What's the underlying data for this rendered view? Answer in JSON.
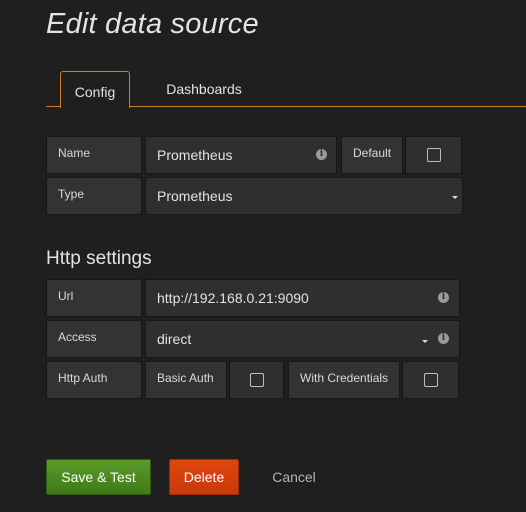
{
  "page": {
    "title": "Edit data source"
  },
  "tabs": [
    {
      "label": "Config",
      "active": true
    },
    {
      "label": "Dashboards",
      "active": false
    }
  ],
  "general": {
    "name_label": "Name",
    "name_value": "Prometheus",
    "default_label": "Default",
    "default_checked": false,
    "type_label": "Type",
    "type_value": "Prometheus"
  },
  "http": {
    "section_title": "Http settings",
    "url_label": "Url",
    "url_value": "http://192.168.0.21:9090",
    "access_label": "Access",
    "access_value": "direct",
    "auth_label": "Http Auth",
    "basic_auth_label": "Basic Auth",
    "basic_auth_checked": false,
    "with_credentials_label": "With Credentials",
    "with_credentials_checked": false
  },
  "actions": {
    "save_label": "Save & Test",
    "delete_label": "Delete",
    "cancel_label": "Cancel"
  },
  "icons": {
    "info": "info-icon",
    "caret": "caret-down-icon"
  },
  "colors": {
    "accent": "#d17e22",
    "save": "#4d8a1e",
    "delete": "#dc4010"
  }
}
